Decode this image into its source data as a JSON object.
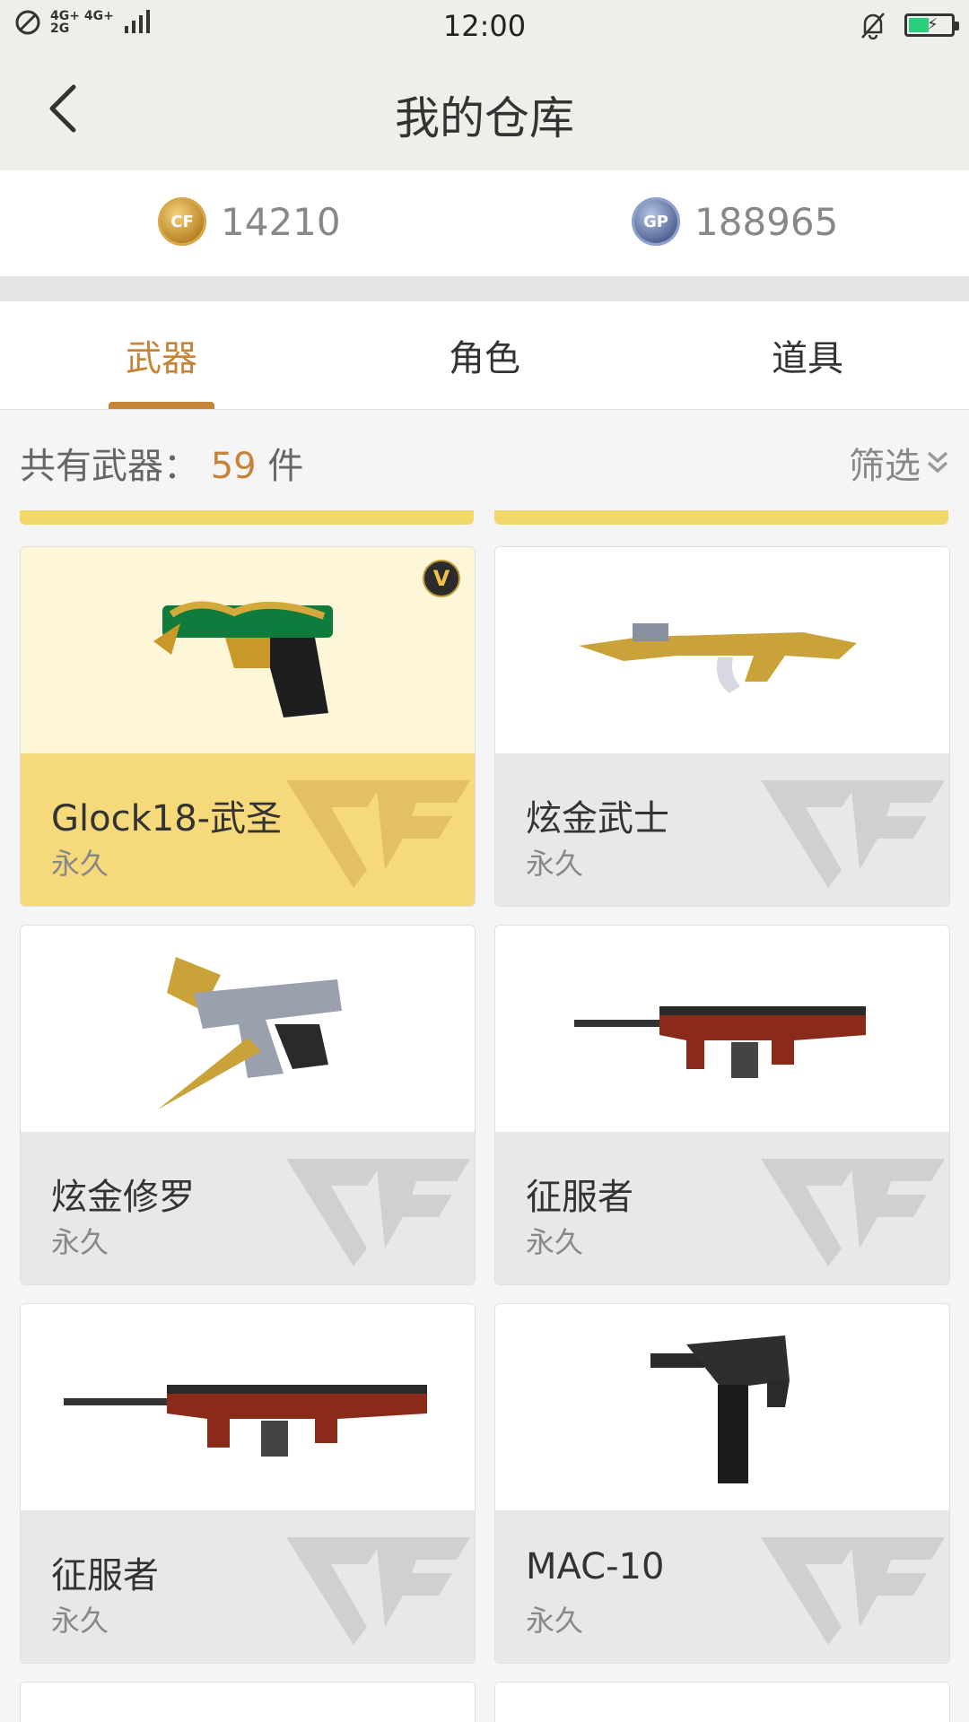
{
  "status_bar": {
    "network": "4G+ 4G+\n2G",
    "time": "12:00"
  },
  "header": {
    "title": "我的仓库"
  },
  "currency": {
    "cf_icon": "CF",
    "cf_amount": "14210",
    "gp_icon": "GP",
    "gp_amount": "188965"
  },
  "tabs": [
    {
      "label": "武器",
      "active": true
    },
    {
      "label": "角色",
      "active": false
    },
    {
      "label": "道具",
      "active": false
    }
  ],
  "count_bar": {
    "prefix": "共有武器：",
    "count": "59",
    "unit": "件",
    "filter_label": "筛选"
  },
  "items": [
    {
      "name": "Glock18-武圣",
      "duration": "永久",
      "selected": true,
      "badge": "V",
      "icon": "pistol-icon"
    },
    {
      "name": "炫金武士",
      "duration": "永久",
      "selected": false,
      "icon": "rifle-icon"
    },
    {
      "name": "炫金修罗",
      "duration": "永久",
      "selected": false,
      "icon": "pistol-blade-icon"
    },
    {
      "name": "征服者",
      "duration": "永久",
      "selected": false,
      "icon": "shotgun-icon"
    },
    {
      "name": "征服者",
      "duration": "永久",
      "selected": false,
      "icon": "shotgun-icon"
    },
    {
      "name": "MAC-10",
      "duration": "永久",
      "selected": false,
      "icon": "smg-icon"
    }
  ],
  "colors": {
    "accent": "#c68438",
    "selected_card": "#f5d97a",
    "battery": "#2bd07e"
  }
}
